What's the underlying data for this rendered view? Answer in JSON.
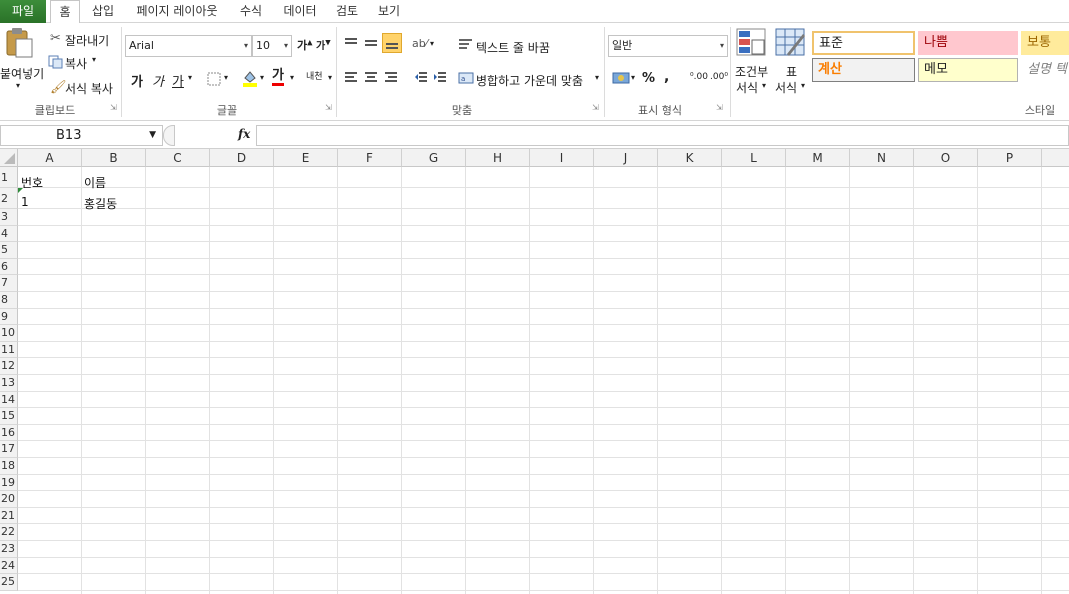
{
  "tabs": [
    "파일",
    "홈",
    "삽입",
    "페이지 레이아웃",
    "수식",
    "데이터",
    "검토",
    "보기"
  ],
  "clipboard": {
    "paste_label": "붙여넣기",
    "cut_label": "잘라내기",
    "copy_label": "복사",
    "format_painter_label": "서식 복사",
    "group_label": "클립보드"
  },
  "font": {
    "font_name": "Arial",
    "font_size": "10",
    "bold": "가",
    "italic": "가",
    "underline": "가",
    "font_color_glyph": "가",
    "group_label": "글꼴"
  },
  "alignment": {
    "wrap_text_label": "텍스트 줄 바꿈",
    "merge_center_label": "병합하고 가운데 맞춤",
    "group_label": "맞춤"
  },
  "number": {
    "format_value": "일반",
    "percent": "%",
    "comma": ",",
    "group_label": "표시 형식"
  },
  "styles": {
    "conditional_format_line1": "조건부",
    "conditional_format_line2": "서식",
    "table_format_line1": "표",
    "table_format_line2": "서식",
    "cells": {
      "normal": "표준",
      "bad": "나쁨",
      "neutral": "보통",
      "calculation": "계산",
      "note": "메모",
      "explanatory": "설명 텍"
    },
    "group_label": "스타일"
  },
  "formula_bar": {
    "name_box": "B13",
    "fx": "fx",
    "formula_value": ""
  },
  "columns": [
    "A",
    "B",
    "C",
    "D",
    "E",
    "F",
    "G",
    "H",
    "I",
    "J",
    "K",
    "L",
    "M",
    "N",
    "O",
    "P"
  ],
  "rows": [
    "1",
    "2",
    "3",
    "4",
    "5",
    "6",
    "7",
    "8",
    "9",
    "10",
    "11",
    "12",
    "13",
    "14",
    "15",
    "16",
    "17",
    "18",
    "19",
    "20",
    "21",
    "22",
    "23",
    "24",
    "25"
  ],
  "cells": {
    "A1": "번호",
    "B1": "이름",
    "A2": "1",
    "B2": "홍길동"
  },
  "colors": {
    "file_tab": "#2e7d32",
    "normal_border": "#f0c36d",
    "bad_bg": "#ffc7ce",
    "bad_text": "#9c0006",
    "neutral_bg": "#ffeb9c",
    "neutral_text": "#9c6500",
    "calc_bg": "#f2f2f2",
    "calc_text": "#fa7d00",
    "note_bg": "#ffffcc"
  }
}
